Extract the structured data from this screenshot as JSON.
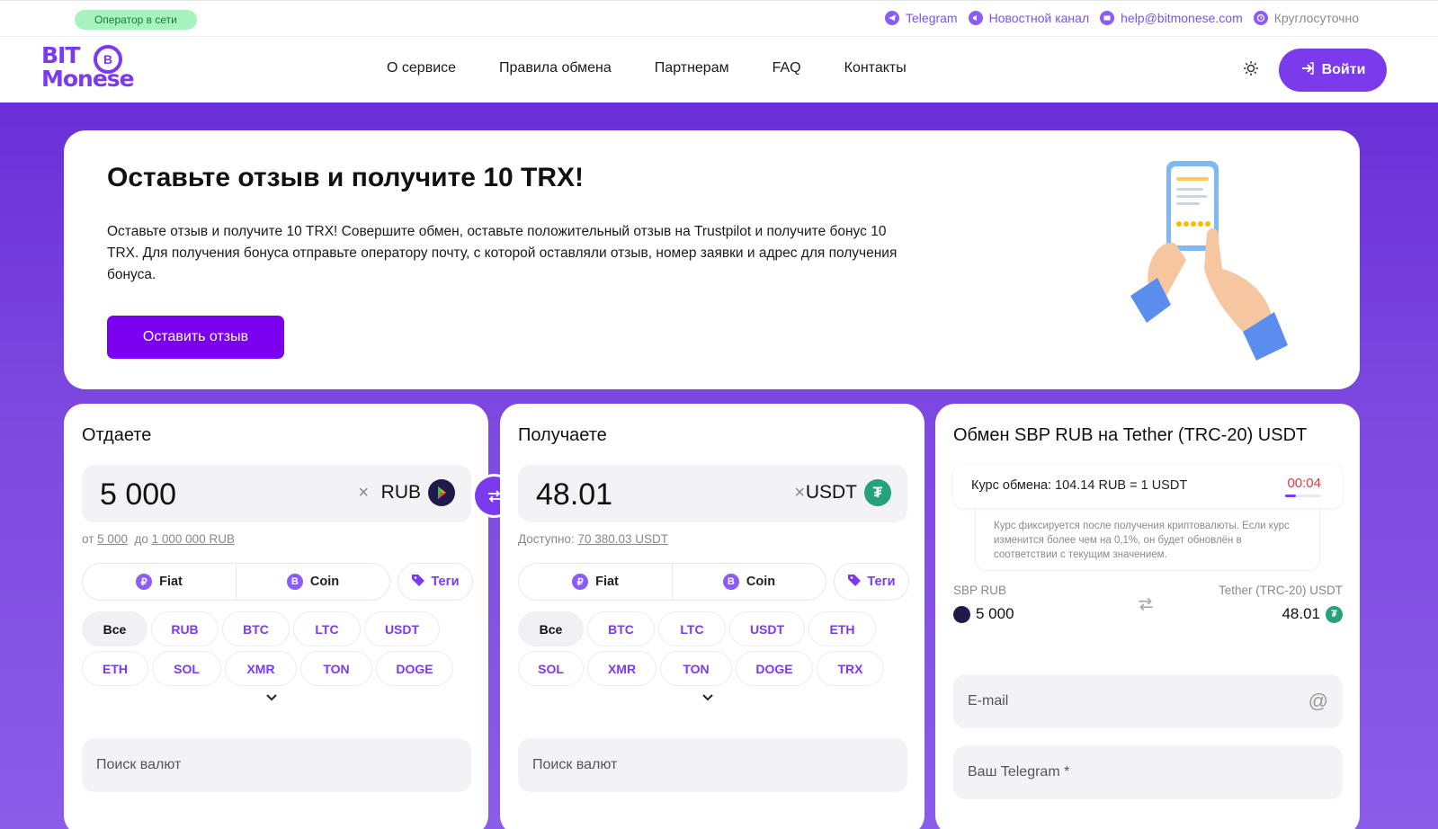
{
  "topbar": {
    "online_badge": "Оператор в сети",
    "links": [
      {
        "label": "Telegram",
        "icon": "telegram-icon"
      },
      {
        "label": "Новостной канал",
        "icon": "megaphone-icon"
      },
      {
        "label": "help@bitmonese.com",
        "icon": "mail-icon"
      },
      {
        "label": "Круглосуточно",
        "icon": "clock-icon"
      }
    ]
  },
  "header": {
    "logo": {
      "line1": "BIT",
      "line2": "Monese",
      "coin": "B"
    },
    "nav": [
      "О сервисе",
      "Правила обмена",
      "Партнерам",
      "FAQ",
      "Контакты"
    ],
    "login_label": "Войти"
  },
  "promo": {
    "title": "Оставьте отзыв и получите 10 TRX!",
    "text": "Оставьте отзыв и получите 10 TRX! Совершите обмен, оставьте положительный отзыв на Trustpilot и получите бонус 10 TRX. Для получения бонуса отправьте оператору почту, с которой оставляли отзыв, номер заявки и адрес для получения бонуса.",
    "button": "Оставить отзыв"
  },
  "give": {
    "title": "Отдаете",
    "amount": "5 000",
    "currency": "RUB",
    "limit_from_label": "от",
    "limit_from": "5 000",
    "limit_to_label": "до",
    "limit_to": "1 000 000 RUB",
    "seg": [
      {
        "label": "Fiat",
        "badge": "₽"
      },
      {
        "label": "Coin",
        "badge": "B"
      }
    ],
    "tags": "Теги",
    "chips": [
      "Все",
      "RUB",
      "BTC",
      "LTC",
      "USDT",
      "ETH",
      "SOL",
      "XMR",
      "TON",
      "DOGE"
    ],
    "search_placeholder": "Поиск валют"
  },
  "get": {
    "title": "Получаете",
    "amount": "48.01",
    "currency": "USDT",
    "available_label": "Доступно:",
    "available": "70 380.03 USDT",
    "seg": [
      {
        "label": "Fiat",
        "badge": "₽"
      },
      {
        "label": "Coin",
        "badge": "B"
      }
    ],
    "tags": "Теги",
    "chips": [
      "Все",
      "BTC",
      "LTC",
      "USDT",
      "ETH",
      "SOL",
      "XMR",
      "TON",
      "DOGE",
      "TRX"
    ],
    "search_placeholder": "Поиск валют"
  },
  "summary": {
    "title": "Обмен SBP RUB на Tether (TRC-20) USDT",
    "rate": "Курс обмена: 104.14 RUB = 1 USDT",
    "timer": "00:04",
    "timer_progress": 0.3,
    "note": "Курс фиксируется после получения криптовалюты. Если курс изменится более чем на 0,1%, он будет обновлён в соответствии с текущим значением.",
    "from_label": "SBP RUB",
    "from_amount": "5 000",
    "to_label": "Tether (TRC-20) USDT",
    "to_amount": "48.01",
    "email_placeholder": "E-mail",
    "telegram_placeholder": "Ваш Telegram *"
  },
  "colors": {
    "accent": "#7c3aed",
    "promo_button": "#7c00f0",
    "online_bg": "#a7f3c0",
    "timer": "#e23b3b"
  }
}
